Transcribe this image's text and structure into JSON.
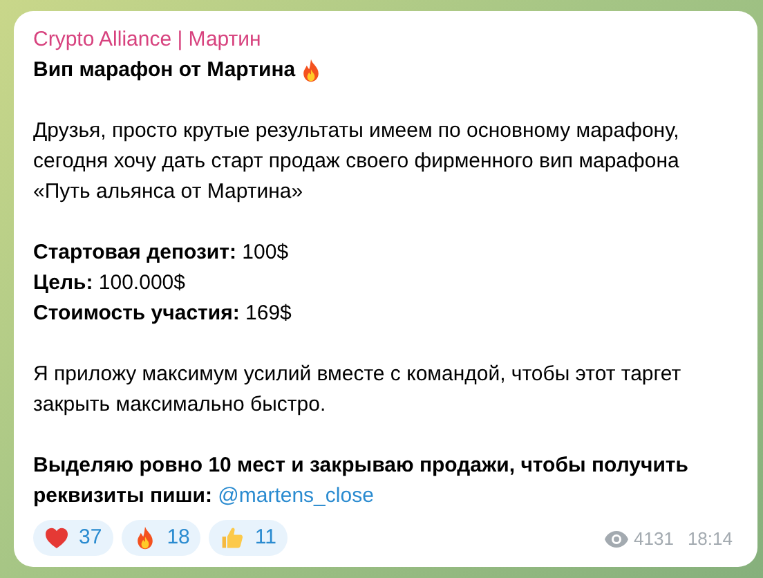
{
  "message": {
    "author": "Crypto Alliance | Мартин",
    "title": "Вип марафон от Мартина",
    "paragraphs": [
      {
        "kind": "text",
        "lines": [
          "Друзья, просто крутые результаты имеем по основному марафону, сегодня хочу дать старт продаж своего фирменного вип марафона «Путь альянса от Мартина»"
        ]
      },
      {
        "kind": "text",
        "lines": [
          "**Стартовая депозит:** 100$",
          "**Цель:** 100.000$",
          "**Стоимость участия:** 169$"
        ]
      },
      {
        "kind": "text",
        "lines": [
          "Я приложу максимум усилий вместе с командой, чтобы этот таргет закрыть максимально быстро."
        ]
      },
      {
        "kind": "link",
        "lines": [
          "**Выделяю ровно 10 мест и закрываю продажи, чтобы получить реквизиты пиши:**"
        ],
        "link": "@martens_close"
      }
    ],
    "reactions": [
      {
        "kind": "heart",
        "count": "37"
      },
      {
        "kind": "fire",
        "count": "18"
      },
      {
        "kind": "thumbs",
        "count": "11"
      }
    ],
    "views": "4131",
    "time": "18:14"
  }
}
